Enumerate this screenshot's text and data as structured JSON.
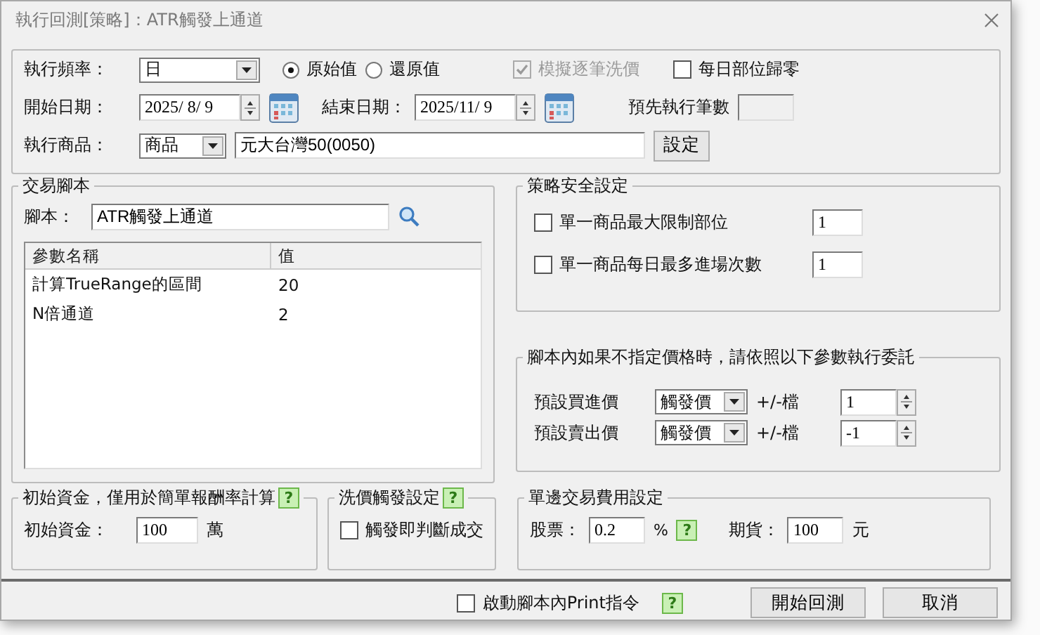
{
  "window": {
    "title": "執行回測[策略]：ATR觸發上通道"
  },
  "run_settings": {
    "frequency": {
      "label": "執行頻率：",
      "value": "日"
    },
    "price_mode": [
      {
        "label": "原始值",
        "selected": true
      },
      {
        "label": "還原值",
        "selected": false
      }
    ],
    "simulate_tick": {
      "label": "模擬逐筆洗價",
      "checked": true,
      "disabled": true
    },
    "daily_reset": {
      "label": "每日部位歸零",
      "checked": false
    },
    "start_date": {
      "label": "開始日期：",
      "value": "2025/ 8/ 9"
    },
    "end_date": {
      "label": "結束日期：",
      "value": "2025/11/ 9"
    },
    "preload_bars": {
      "label": "預先執行筆數"
    },
    "product": {
      "label": "執行商品：",
      "type": "商品",
      "value": "元大台灣50(0050)",
      "button": "設定"
    }
  },
  "script": {
    "title": "交易腳本",
    "label": "腳本：",
    "value": "ATR觸發上通道",
    "columns": [
      "參數名稱",
      "值"
    ],
    "rows": [
      [
        "計算TrueRange的區間",
        "20"
      ],
      [
        "N倍通道",
        "2"
      ]
    ]
  },
  "safety": {
    "title": "策略安全設定",
    "items": [
      {
        "label": "單一商品最大限制部位",
        "checked": false,
        "value": "1"
      },
      {
        "label": "單一商品每日最多進場次數",
        "checked": false,
        "value": "1"
      }
    ]
  },
  "default_price": {
    "title": "腳本內如果不指定價格時，請依照以下參數執行委託",
    "rows": [
      {
        "label": "預設買進價",
        "type": "觸發價",
        "unit": "+/-檔",
        "value": "1"
      },
      {
        "label": "預設賣出價",
        "type": "觸發價",
        "unit": "+/-檔",
        "value": "-1"
      }
    ]
  },
  "capital": {
    "title": "初始資金，僅用於簡單報酬率計算",
    "help": "?",
    "label": "初始資金：",
    "value": "100",
    "unit": "萬"
  },
  "wash": {
    "title": "洗價觸發設定",
    "help": "?",
    "option": {
      "label": "觸發即判斷成交",
      "checked": false
    }
  },
  "fees": {
    "title": "單邊交易費用設定",
    "stock_label": "股票：",
    "stock_value": "0.2",
    "stock_unit": "%",
    "help": "?",
    "futures_label": "期貨：",
    "futures_value": "100",
    "futures_unit": "元"
  },
  "footer": {
    "print_option": {
      "label": "啟動腳本內Print指令",
      "checked": false
    },
    "help": "?",
    "buttons": [
      "開始回測",
      "取消"
    ]
  }
}
